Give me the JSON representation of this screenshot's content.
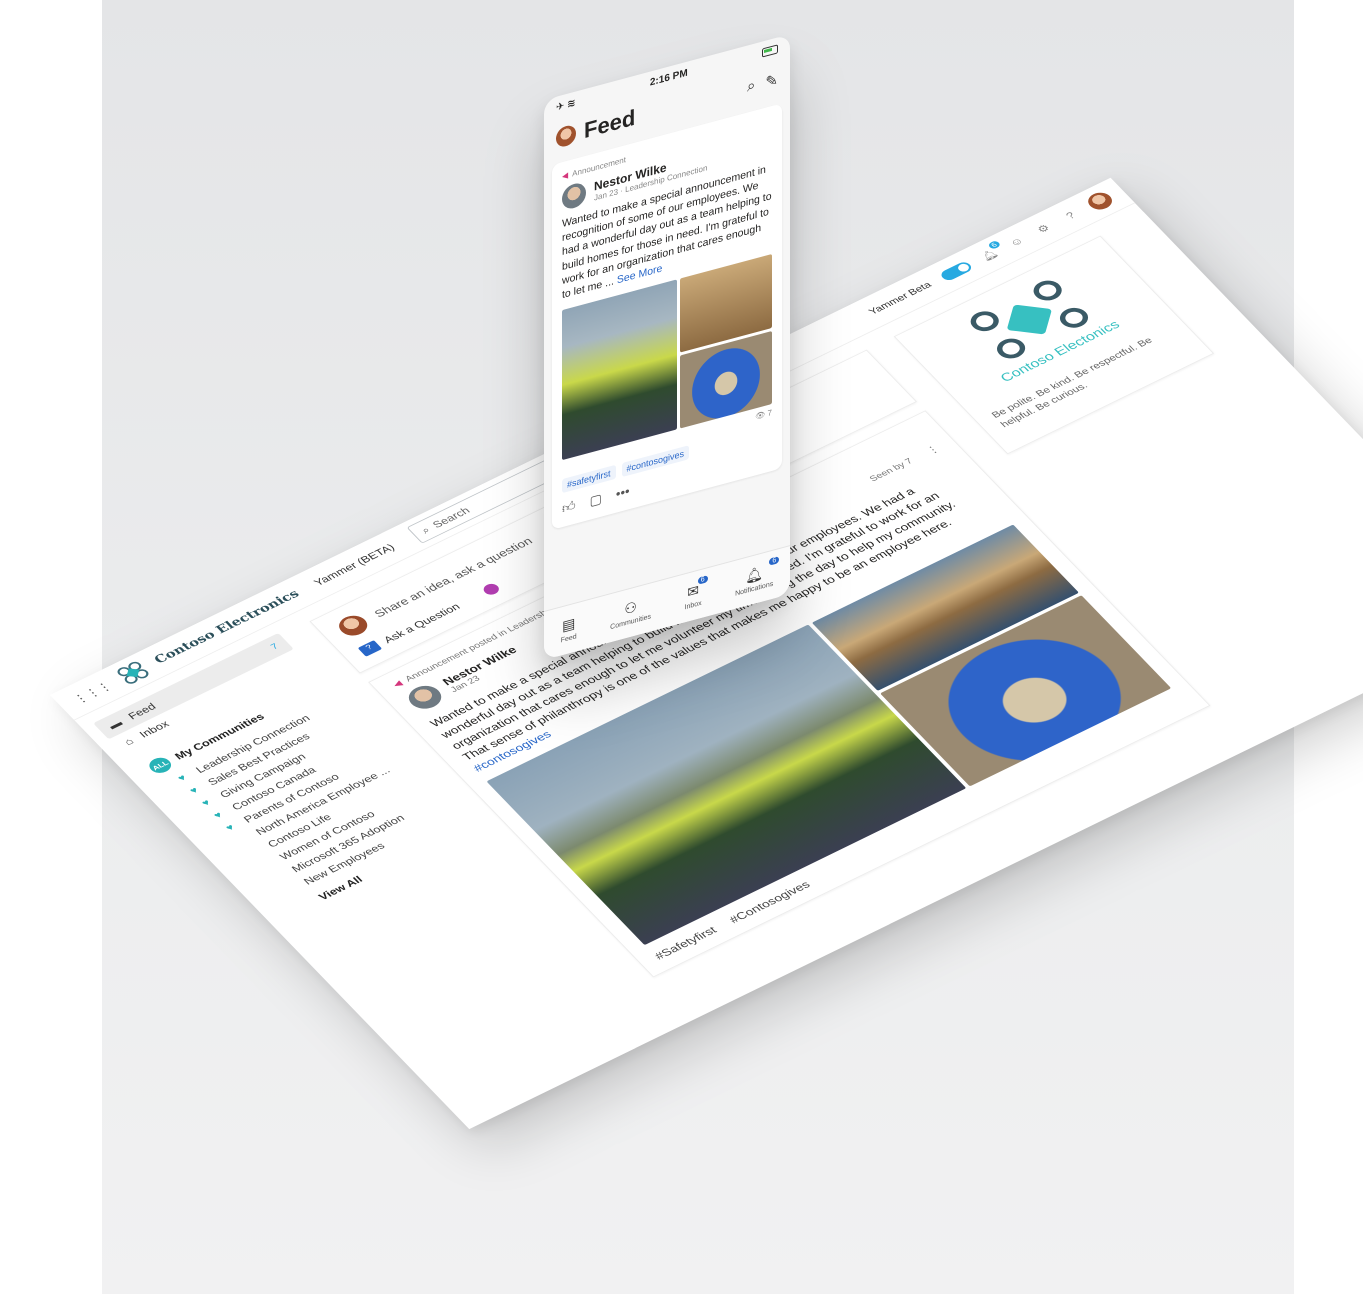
{
  "desktop": {
    "brand": "Contoso Electronics",
    "product": "Yammer (BETA)",
    "search_placeholder": "Search",
    "beta_label": "Yammer Beta",
    "notification_count": "6",
    "help": "?",
    "nav": [
      {
        "label": "Feed",
        "count": "7"
      },
      {
        "label": "Inbox",
        "count": ""
      }
    ],
    "communities_title": "My Communities",
    "communities_badge": "ALL",
    "communities": [
      {
        "label": "Leadership Connection",
        "fav": true
      },
      {
        "label": "Sales Best Practices",
        "fav": true
      },
      {
        "label": "Giving Campaign",
        "fav": true
      },
      {
        "label": "Contoso Canada",
        "fav": true
      },
      {
        "label": "Parents of Contoso",
        "fav": true
      },
      {
        "label": "North America Employee ...",
        "fav": false
      },
      {
        "label": "Contoso Life",
        "fav": false
      },
      {
        "label": "Women of Contoso",
        "fav": false
      },
      {
        "label": "Microsoft 365 Adoption",
        "fav": false
      },
      {
        "label": "New Employees",
        "fav": false
      }
    ],
    "view_all": "View All",
    "composer": {
      "placeholder": "Share an idea, ask a question",
      "ask": "Ask a Question"
    },
    "post": {
      "meta": "Announcement posted in Leadership Connection",
      "author": "Nestor Wilke",
      "date": "Jan 23",
      "seen": "Seen by 7",
      "body": "Wanted to make a special announcement in recognition of some of our employees. We had a wonderful day out as a team helping to build homes for those in need. I'm grateful to work for an organization that cares enough to let me volunteer my time during the day to help my community. That sense of philanthropy is one of the values that makes me happy to be an employee here.",
      "tag_inline": "#contosogives",
      "hashtags": [
        "#Safetyfirst",
        "#Contosogives"
      ]
    },
    "right_card": {
      "name": "Contoso Electonics",
      "description": "Be polite. Be kind. Be respectful. Be helpful. Be curious."
    }
  },
  "phone": {
    "time": "2:16 PM",
    "title": "Feed",
    "announcement": "Announcement",
    "author": "Nestor Wilke",
    "sub": "Jan 23 · Leadership Connection",
    "body": "Wanted to make a special announcement in recognition of some of our employees. We had a wonderful day out as a team helping to build homes for those in need. I'm grateful to work for an organization that cares enough to let me ...",
    "see_more": "See More",
    "views": "7",
    "tags": [
      "#safetyfirst",
      "#contosogives"
    ],
    "tabs": [
      {
        "label": "Feed",
        "icon": "feed-icon",
        "badge": ""
      },
      {
        "label": "Communities",
        "icon": "communities-icon",
        "badge": ""
      },
      {
        "label": "Inbox",
        "icon": "inbox-icon",
        "badge": "6"
      },
      {
        "label": "Notifications",
        "icon": "bell-icon",
        "badge": "6"
      }
    ]
  },
  "colors": {
    "accent": "#27a9e1",
    "brand_teal": "#37c0c1",
    "link": "#2766c8"
  }
}
